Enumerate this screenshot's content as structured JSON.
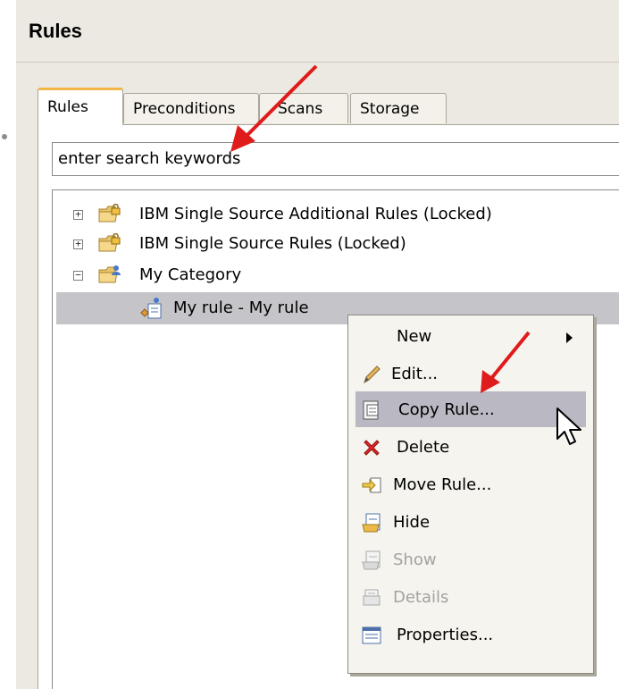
{
  "panel": {
    "title": "Rules"
  },
  "tabs": [
    {
      "label": "Rules",
      "active": true
    },
    {
      "label": "Preconditions",
      "active": false
    },
    {
      "label": "Scans",
      "active": false
    },
    {
      "label": "Storage",
      "active": false
    }
  ],
  "search": {
    "value": "enter search keywords"
  },
  "tree": {
    "items": [
      {
        "label": "IBM Single Source Additional Rules (Locked)",
        "expander": "+"
      },
      {
        "label": "IBM Single Source Rules (Locked)",
        "expander": "+"
      },
      {
        "label": "My Category",
        "expander": "−"
      },
      {
        "label": "My rule - My rule",
        "selected": true
      }
    ]
  },
  "context_menu": {
    "items": [
      {
        "label": "New",
        "submenu": true,
        "enabled": true
      },
      {
        "label": "Edit...",
        "icon": "pencil-icon",
        "enabled": true
      },
      {
        "label": "Copy Rule...",
        "icon": "copy-icon",
        "enabled": true,
        "highlighted": true
      },
      {
        "label": "Delete",
        "icon": "red-x-icon",
        "enabled": true
      },
      {
        "label": "Move Rule...",
        "icon": "move-icon",
        "enabled": true
      },
      {
        "label": "Hide",
        "icon": "hide-icon",
        "enabled": true
      },
      {
        "label": "Show",
        "icon": "show-icon",
        "enabled": false
      },
      {
        "label": "Details",
        "icon": "details-icon",
        "enabled": false
      },
      {
        "label": "Properties...",
        "icon": "properties-icon",
        "enabled": true
      }
    ]
  },
  "colors": {
    "accent_tab": "#f2b646",
    "arrow": "#e01b1b",
    "selection": "#c5c4c9"
  }
}
